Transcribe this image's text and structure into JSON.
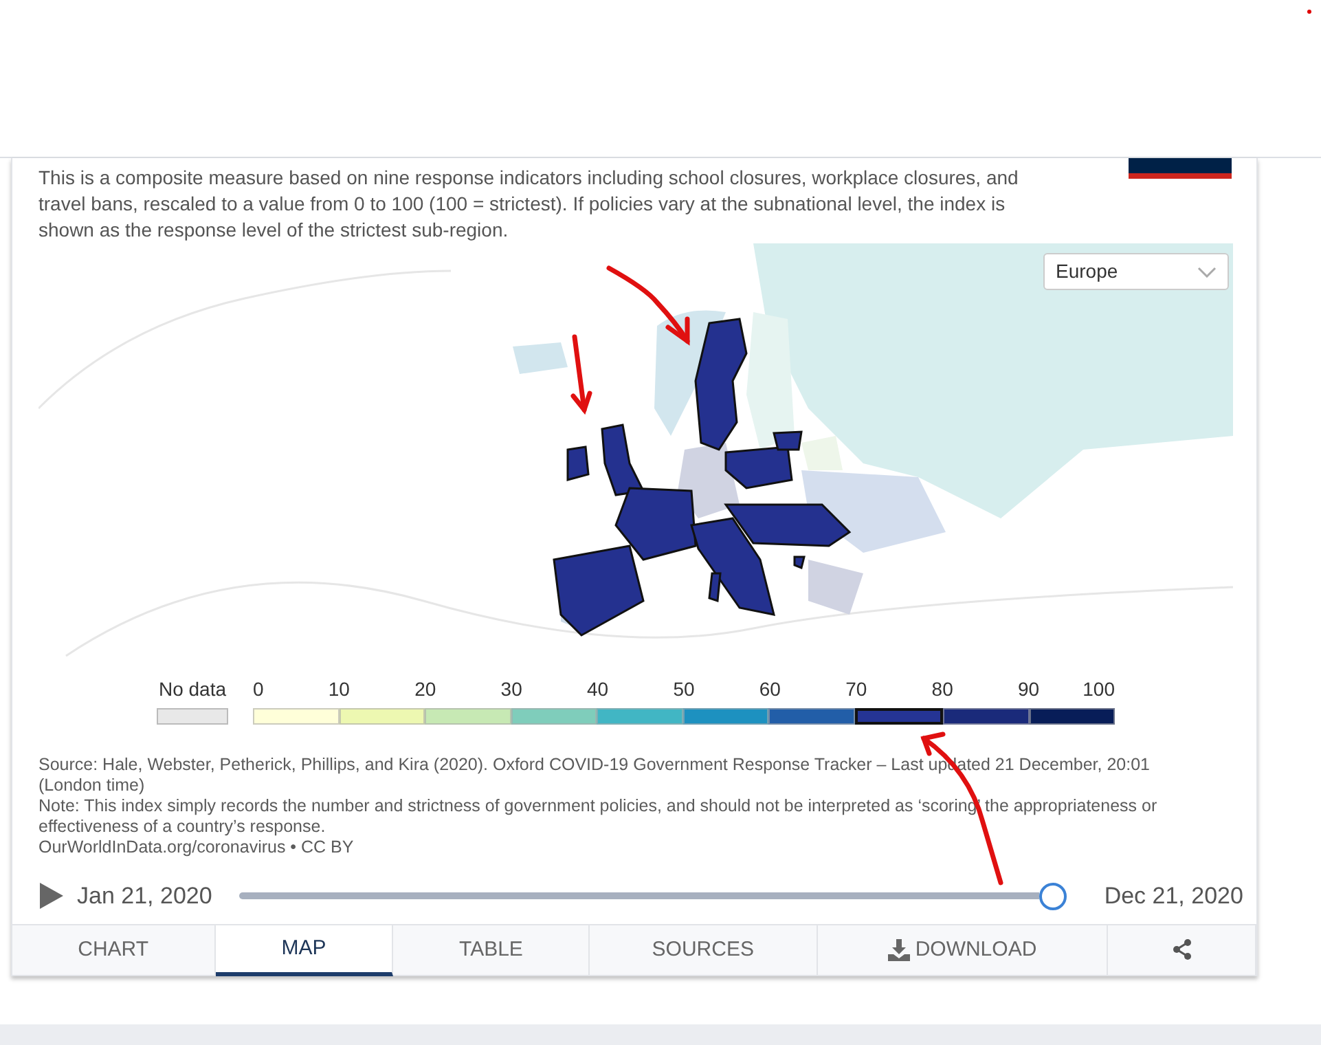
{
  "description": "This is a composite measure based on nine response indicators including school closures, workplace closures, and travel bans, rescaled to a value from 0 to 100 (100 = strictest). If policies vary at the subnational level, the index is shown as the response level of the strictest sub-region.",
  "region_select": {
    "value": "Europe"
  },
  "legend": {
    "no_data_label": "No data",
    "ticks": [
      "0",
      "10",
      "20",
      "30",
      "40",
      "50",
      "60",
      "70",
      "80",
      "90",
      "100"
    ],
    "bins": [
      {
        "color": "#ffffd9",
        "selected": false
      },
      {
        "color": "#edf8b1",
        "selected": false
      },
      {
        "color": "#c7e9b4",
        "selected": false
      },
      {
        "color": "#7fcdbb",
        "selected": false
      },
      {
        "color": "#41b6c4",
        "selected": false
      },
      {
        "color": "#1d91c0",
        "selected": false
      },
      {
        "color": "#225ea8",
        "selected": false
      },
      {
        "color": "#253494",
        "selected": true
      },
      {
        "color": "#1a2a7a",
        "selected": false
      },
      {
        "color": "#081d58",
        "selected": false
      }
    ]
  },
  "sources": [
    "Source: Hale, Webster, Petherick, Phillips, and Kira (2020). Oxford COVID-19 Government Response Tracker – Last updated 21 December, 20:01 (London time)",
    "Note: This index simply records the number and strictness of government policies, and should not be interpreted as ‘scoring’ the appropriateness or effectiveness of a country’s response.",
    "OurWorldInData.org/coronavirus • CC BY"
  ],
  "timeline": {
    "start": "Jan 21, 2020",
    "end": "Dec 21, 2020",
    "level": 1.0
  },
  "tabs": [
    {
      "label": "CHART",
      "kind": "text",
      "selected": false
    },
    {
      "label": "MAP",
      "kind": "text",
      "selected": true
    },
    {
      "label": "TABLE",
      "kind": "text",
      "selected": false
    },
    {
      "label": "SOURCES",
      "kind": "text",
      "selected": false
    },
    {
      "label": "DOWNLOAD",
      "kind": "download",
      "selected": false
    },
    {
      "kind": "share",
      "selected": false
    }
  ]
}
